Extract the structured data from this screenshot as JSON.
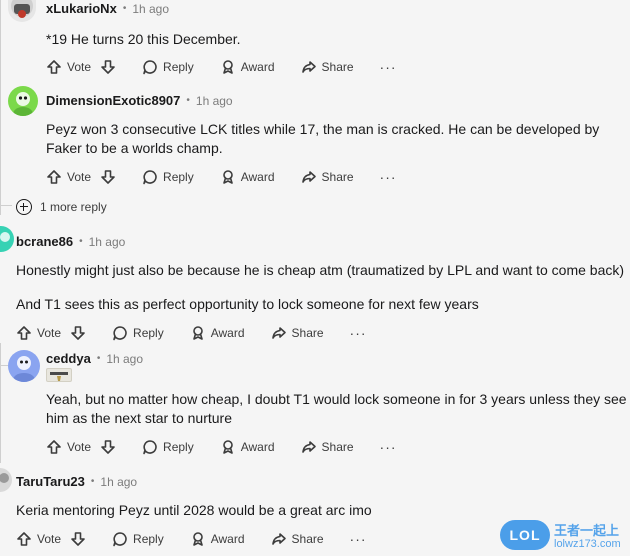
{
  "comments": [
    {
      "username": "xLukarioNx",
      "time": "1h ago",
      "text": "*19 He turns 20 this December.",
      "actions": {
        "vote": "Vote",
        "reply": "Reply",
        "award": "Award",
        "share": "Share"
      }
    },
    {
      "username": "DimensionExotic8907",
      "time": "1h ago",
      "text": "Peyz won 3 consecutive LCK titles while 17, the man is cracked. He can be developed by Faker to be a worlds champ.",
      "actions": {
        "vote": "Vote",
        "reply": "Reply",
        "award": "Award",
        "share": "Share"
      }
    },
    {
      "username": "bcrane86",
      "time": "1h ago",
      "text": "Honestly might just also be because he is cheap atm (traumatized by LPL and want to come back)",
      "text2": "And T1 sees this as perfect opportunity to lock someone for next few years",
      "actions": {
        "vote": "Vote",
        "reply": "Reply",
        "award": "Award",
        "share": "Share"
      }
    },
    {
      "username": "ceddya",
      "time": "1h ago",
      "text": "Yeah, but no matter how cheap, I doubt T1 would lock someone in for 3 years unless they see him as the next star to nurture",
      "actions": {
        "vote": "Vote",
        "reply": "Reply",
        "award": "Award",
        "share": "Share"
      }
    },
    {
      "username": "TaruTaru23",
      "time": "1h ago",
      "text": "Keria mentoring Peyz until 2028 would be a great arc imo",
      "actions": {
        "vote": "Vote",
        "reply": "Reply",
        "award": "Award",
        "share": "Share"
      }
    }
  ],
  "more_reply": "1 more reply",
  "separator": "•",
  "more_dots": "···",
  "watermark": {
    "logo": "LOL",
    "brand": "王者一起上",
    "url": "lolwz173.com"
  },
  "colors": {
    "background": "#f5f5f5",
    "avatar_green": "#7bd94a",
    "avatar_teal": "#37d2b4",
    "avatar_blue": "#8aa4f0",
    "watermark_blue": "#2e8fe8"
  }
}
